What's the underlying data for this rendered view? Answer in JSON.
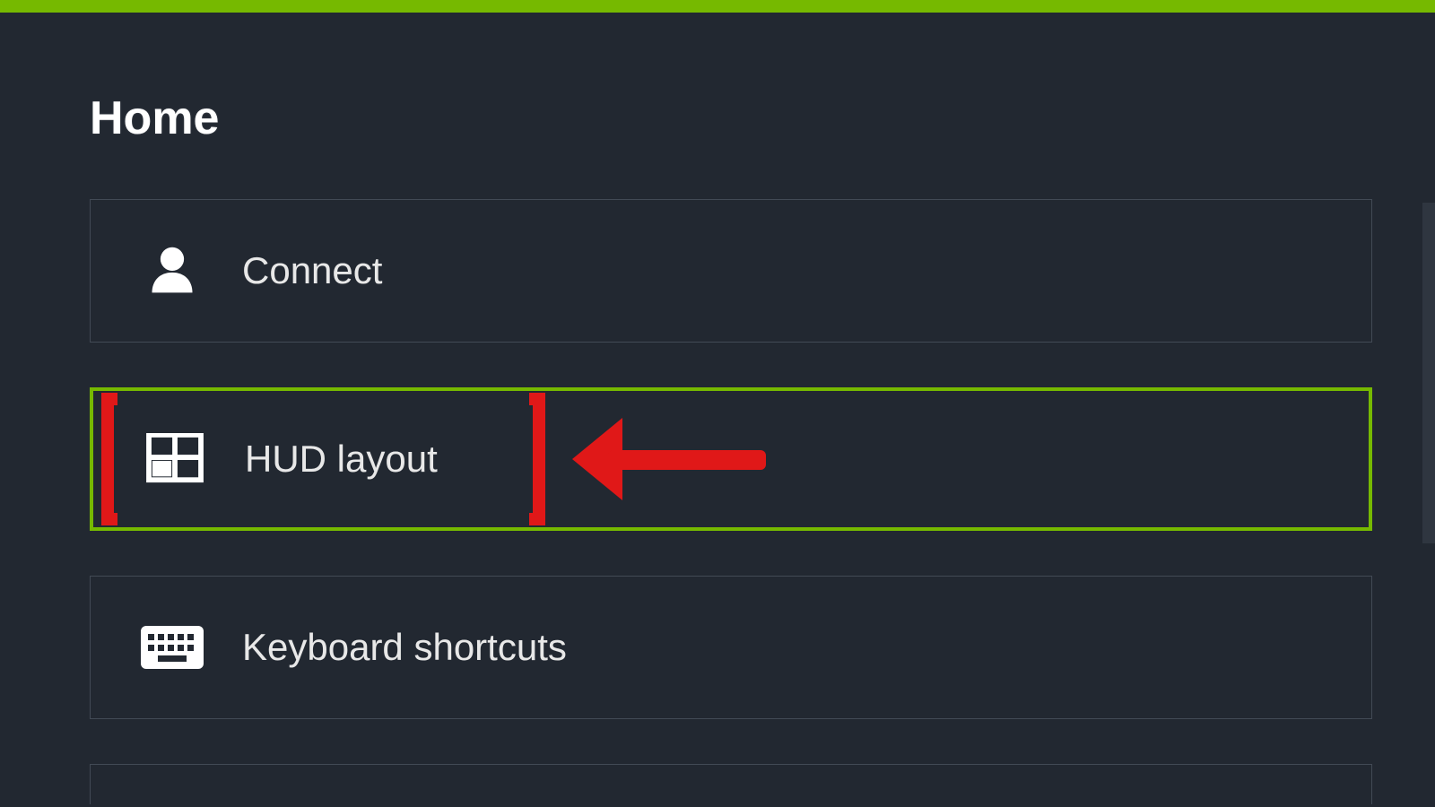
{
  "colors": {
    "accent": "#76b900",
    "annotation": "#e01818",
    "bg": "#222831"
  },
  "page": {
    "title": "Home"
  },
  "items": [
    {
      "id": "connect",
      "label": "Connect",
      "icon": "user-icon",
      "highlighted": false
    },
    {
      "id": "hud",
      "label": "HUD layout",
      "icon": "grid-icon",
      "highlighted": true
    },
    {
      "id": "shortcuts",
      "label": "Keyboard shortcuts",
      "icon": "keyboard-icon",
      "highlighted": false
    }
  ]
}
